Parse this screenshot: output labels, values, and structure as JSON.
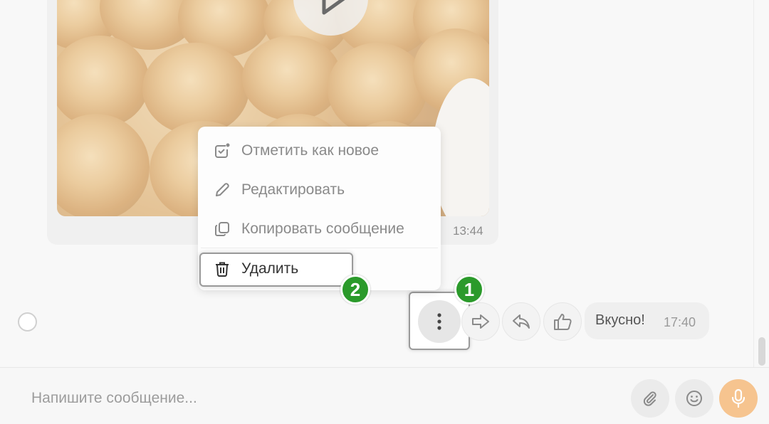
{
  "media_message": {
    "time": "13:44"
  },
  "context_menu": {
    "items": [
      {
        "label": "Отметить как новое",
        "icon": "mark-unread-icon"
      },
      {
        "label": "Редактировать",
        "icon": "pencil-icon"
      },
      {
        "label": "Копировать сообщение",
        "icon": "copy-icon"
      },
      {
        "label": "Удалить",
        "icon": "trash-icon"
      }
    ]
  },
  "message": {
    "text": "Вкусно!",
    "time": "17:40"
  },
  "actions": [
    "more-icon",
    "forward-icon",
    "reply-icon",
    "like-icon"
  ],
  "badges": {
    "step1": "1",
    "step2": "2"
  },
  "composer": {
    "placeholder": "Напишите сообщение...",
    "buttons": [
      "attach-icon",
      "emoji-icon",
      "microphone-icon"
    ]
  },
  "colors": {
    "badge": "#2b9a2b",
    "mic_accent": "#f6c48f"
  }
}
